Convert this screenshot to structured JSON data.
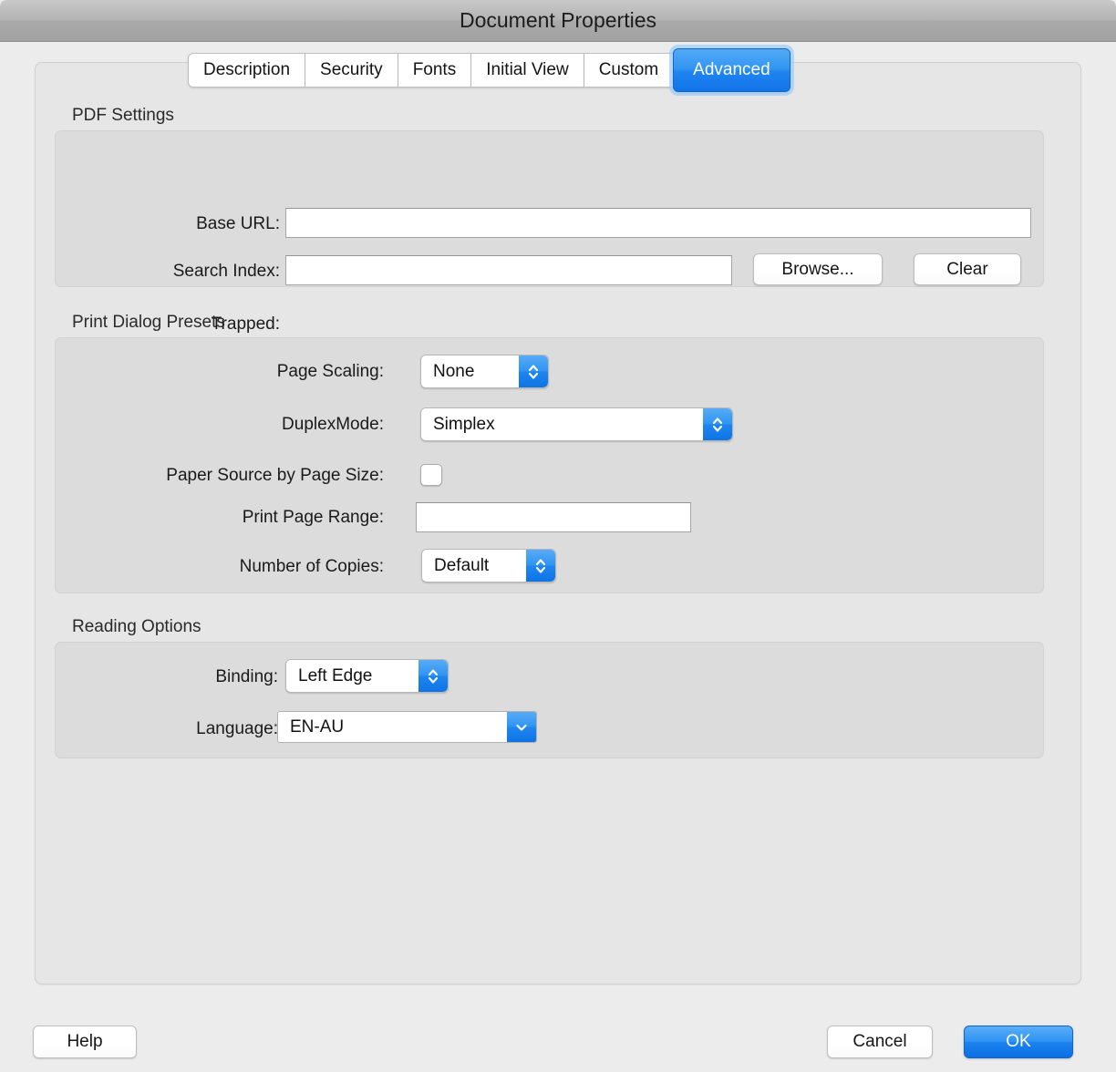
{
  "window": {
    "title": "Document Properties"
  },
  "tabs": [
    {
      "label": "Description",
      "active": false
    },
    {
      "label": "Security",
      "active": false
    },
    {
      "label": "Fonts",
      "active": false
    },
    {
      "label": "Initial View",
      "active": false
    },
    {
      "label": "Custom",
      "active": false
    },
    {
      "label": "Advanced",
      "active": true
    }
  ],
  "colors": {
    "accent_blue": "#1f84ef",
    "titlebar_gray": "#b4b4b4",
    "panel_gray": "#e6e6e6",
    "group_gray": "#dcdcdc"
  },
  "pdf_settings": {
    "title": "PDF Settings",
    "base_url": {
      "label": "Base URL:",
      "value": "",
      "placeholder": ""
    },
    "search_index": {
      "label": "Search Index:",
      "value": "",
      "placeholder": ""
    },
    "browse_button": "Browse...",
    "clear_button": "Clear",
    "trapped": {
      "label": "Trapped:",
      "value": ""
    }
  },
  "print_dialog_presets": {
    "title": "Print Dialog Presets",
    "page_scaling": {
      "label": "Page Scaling:",
      "value": "None",
      "icon": "stepper-updown-icon"
    },
    "duplex_mode": {
      "label": "DuplexMode:",
      "value": "Simplex",
      "icon": "stepper-updown-icon"
    },
    "paper_source_by_page_size": {
      "label": "Paper Source by Page Size:",
      "checked": false
    },
    "print_page_range": {
      "label": "Print Page Range:",
      "value": "",
      "placeholder": ""
    },
    "number_of_copies": {
      "label": "Number of Copies:",
      "value": "Default",
      "icon": "stepper-updown-icon"
    }
  },
  "reading_options": {
    "title": "Reading Options",
    "binding": {
      "label": "Binding:",
      "value": "Left Edge",
      "icon": "stepper-updown-icon"
    },
    "language": {
      "label": "Language:",
      "value": "EN-AU",
      "icon": "chevron-down-icon"
    }
  },
  "footer": {
    "help_button": "Help",
    "cancel_button": "Cancel",
    "ok_button": "OK"
  }
}
